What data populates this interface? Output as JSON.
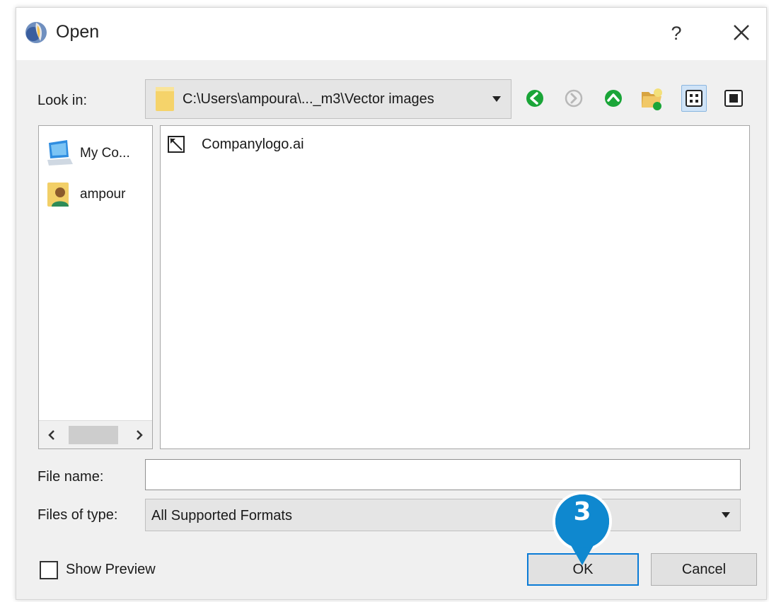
{
  "window": {
    "title": "Open",
    "help_label": "?",
    "app_icon": "app-logo-icon",
    "close_icon": "close-icon"
  },
  "look_in": {
    "label": "Look in:",
    "path": "C:\\Users\\ampoura\\..._m3\\Vector images",
    "folder_icon": "folder-icon"
  },
  "toolbar": {
    "buttons": [
      {
        "icon": "back-arrow-icon",
        "enabled": true,
        "color": "#1aa538"
      },
      {
        "icon": "forward-arrow-icon",
        "enabled": false,
        "color": "#b8b8b8"
      },
      {
        "icon": "up-folder-icon",
        "enabled": true,
        "color": "#1aa538"
      },
      {
        "icon": "new-folder-icon",
        "enabled": true
      },
      {
        "icon": "list-view-icon",
        "enabled": true,
        "active": true
      },
      {
        "icon": "detail-view-icon",
        "enabled": true
      }
    ]
  },
  "sidebar": {
    "items": [
      {
        "label": "My Co...",
        "icon": "computer-icon"
      },
      {
        "label": "ampour",
        "icon": "user-folder-icon"
      }
    ],
    "scroll_left": "<",
    "scroll_right": ">"
  },
  "files": [
    {
      "name": "Companylogo.ai",
      "icon": "vector-file-icon"
    }
  ],
  "file_name": {
    "label": "File name:",
    "value": ""
  },
  "file_type": {
    "label": "Files of type:",
    "value": "All Supported Formats"
  },
  "show_preview": {
    "label": "Show Preview",
    "checked": false
  },
  "buttons": {
    "ok_label": "OK",
    "cancel_label": "Cancel"
  },
  "callout": {
    "number": "3",
    "color": "#0f88cf"
  }
}
